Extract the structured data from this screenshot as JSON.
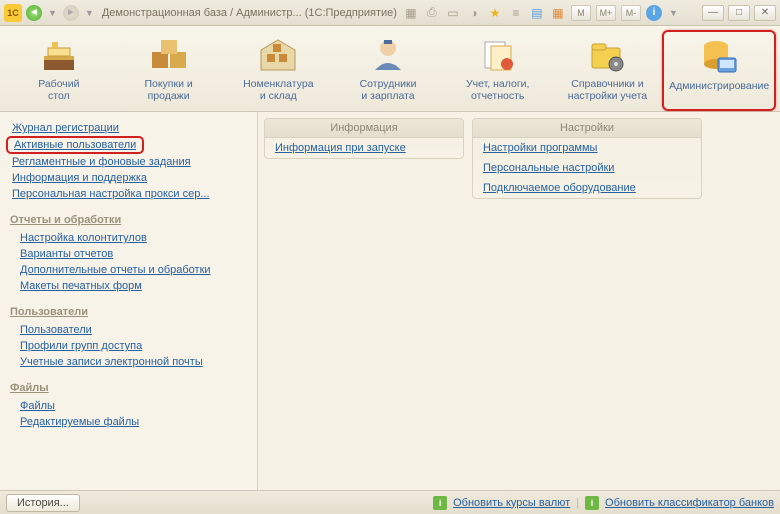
{
  "titlebar": {
    "logo": "1C",
    "title": "Демонстрационная база / Администр...   (1С:Предприятие)",
    "m_buttons": [
      "M",
      "M+",
      "M-"
    ]
  },
  "toolbar": {
    "items": [
      {
        "label": "Рабочий\nстол"
      },
      {
        "label": "Покупки и\nпродажи"
      },
      {
        "label": "Номенклатура\nи склад"
      },
      {
        "label": "Сотрудники\nи зарплата"
      },
      {
        "label": "Учет, налоги,\nотчетность"
      },
      {
        "label": "Справочники и\nнастройки учета"
      },
      {
        "label": "Администрирование"
      }
    ]
  },
  "sidebar": {
    "top": [
      "Журнал регистрации",
      "Активные пользователи",
      "Регламентные и фоновые задания",
      "Информация и поддержка",
      "Персональная настройка прокси сер..."
    ],
    "groups": [
      {
        "title": "Отчеты и обработки",
        "items": [
          "Настройка колонтитулов",
          "Варианты отчетов",
          "Дополнительные отчеты и обработки",
          "Макеты печатных форм"
        ]
      },
      {
        "title": "Пользователи",
        "items": [
          "Пользователи",
          "Профили групп доступа",
          "Учетные записи электронной почты"
        ]
      },
      {
        "title": "Файлы",
        "items": [
          "Файлы",
          "Редактируемые файлы"
        ]
      }
    ]
  },
  "panels": {
    "info": {
      "title": "Информация",
      "items": [
        "Информация при запуске"
      ]
    },
    "settings": {
      "title": "Настройки",
      "items": [
        "Настройки программы",
        "Персональные настройки",
        "Подключаемое оборудование"
      ]
    }
  },
  "statusbar": {
    "history": "История...",
    "link1": "Обновить курсы валют",
    "link2": "Обновить классификатор банков"
  }
}
